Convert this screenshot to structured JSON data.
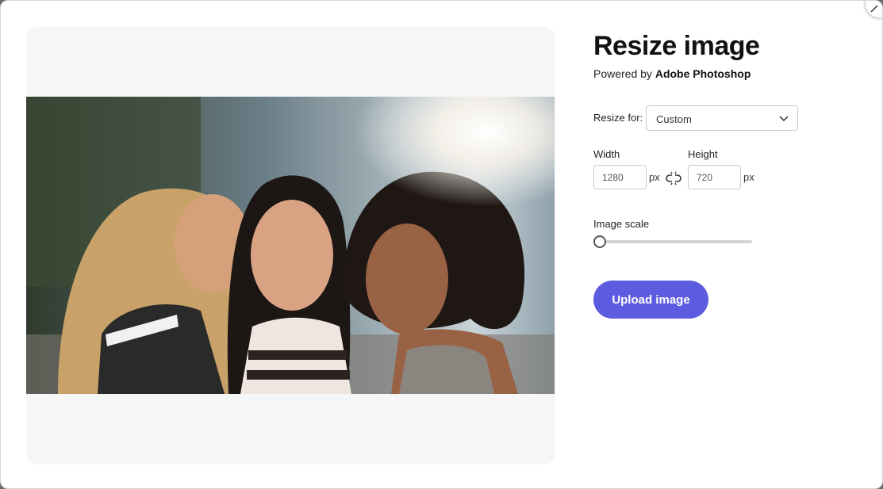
{
  "dialog": {
    "title": "Resize image",
    "powered_prefix": "Powered by",
    "powered_brand": "Adobe Photoshop"
  },
  "resize_for": {
    "label": "Resize for:",
    "selected": "Custom"
  },
  "dimensions": {
    "width_label": "Width",
    "width_value": "1280",
    "height_label": "Height",
    "height_value": "720",
    "unit": "px"
  },
  "scale": {
    "label": "Image scale",
    "value": 0
  },
  "upload_label": "Upload image",
  "colors": {
    "accent": "#5c5ce0",
    "panel_bg": "#f6f6f6"
  }
}
